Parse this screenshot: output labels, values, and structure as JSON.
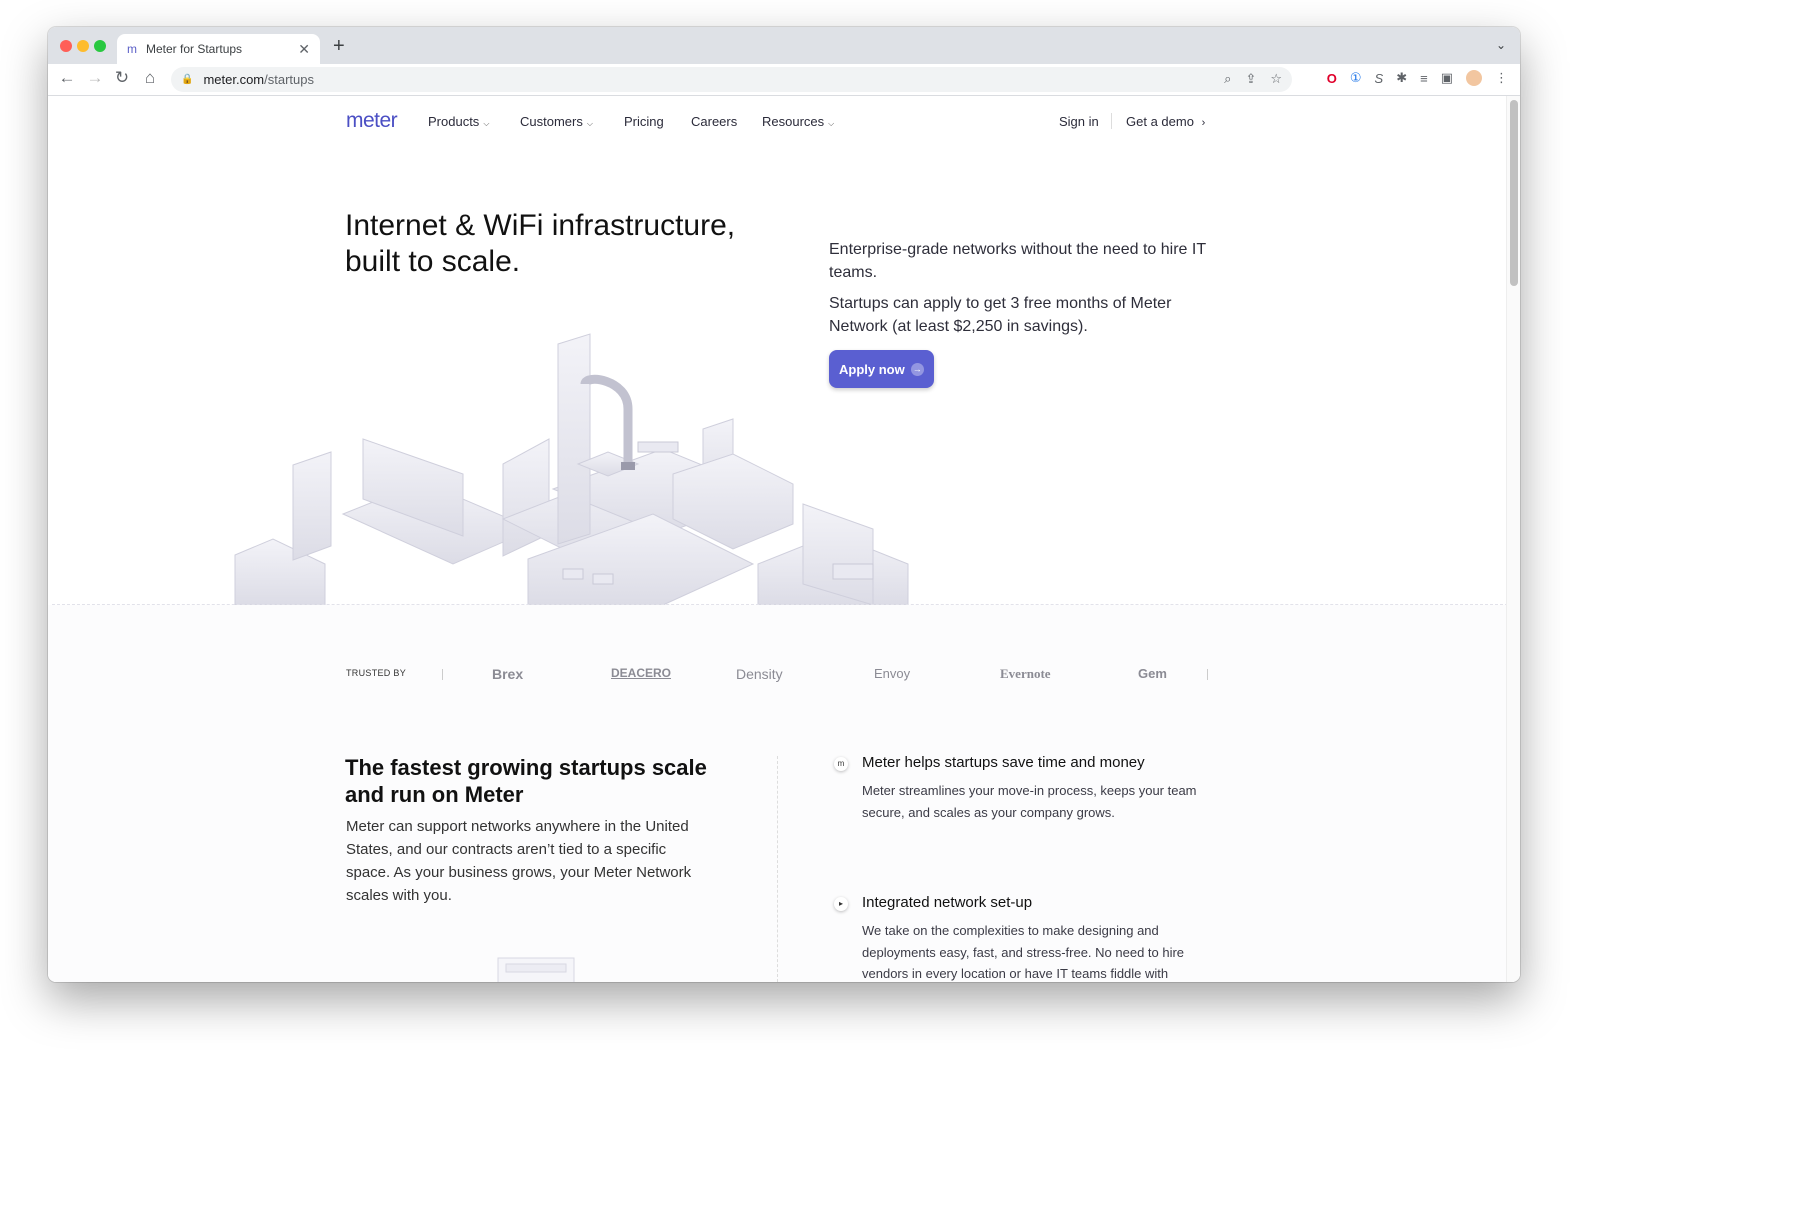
{
  "browser": {
    "tab_title": "Meter for Startups",
    "tab_favicon": "m",
    "url_host": "meter.com",
    "url_path": "/startups"
  },
  "site": {
    "logo": "meter",
    "nav": {
      "products": "Products",
      "customers": "Customers",
      "pricing": "Pricing",
      "careers": "Careers",
      "resources": "Resources",
      "signin": "Sign in",
      "demo": "Get a demo"
    }
  },
  "hero": {
    "title": "Internet & WiFi infrastructure, built to scale.",
    "p1": "Enterprise-grade networks without the need to hire IT teams.",
    "p2": "Startups can apply to get 3 free months of Meter Network (at least $2,250 in savings).",
    "cta": "Apply now"
  },
  "trusted": {
    "label": "TRUSTED BY",
    "brands": [
      "Brex",
      "DEACERO",
      "Density",
      "Envoy",
      "Evernote",
      "Gem"
    ]
  },
  "section": {
    "title": "The fastest growing startups scale and run on Meter",
    "body": "Meter can support networks anywhere in the United States, and our contracts aren’t tied to a specific space. As your business grows, your Meter Network scales with you."
  },
  "features": [
    {
      "title": "Meter helps startups save time and money",
      "body": "Meter streamlines your move-in process, keeps your team secure, and scales as your company grows."
    },
    {
      "title": "Integrated network set-up",
      "body": "We take on the complexities to make designing and deployments easy, fast, and stress-free. No need to hire vendors in every location or have IT teams fiddle with manual configurations — everything is automated with"
    }
  ],
  "colors": {
    "brand": "#5a5fd1",
    "logo": "#4b4fc4"
  }
}
